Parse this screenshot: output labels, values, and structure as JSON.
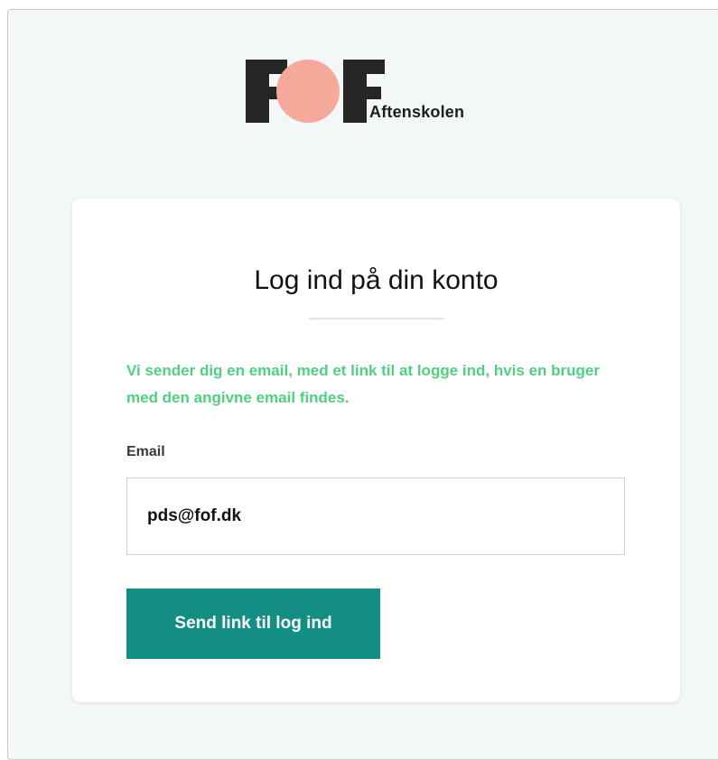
{
  "brand": {
    "logo_letters": "FOF",
    "subtitle": "Aftenskolen",
    "colors": {
      "dark": "#262626",
      "circle": "#f5a99b"
    }
  },
  "login": {
    "title": "Log ind på din konto",
    "notice": "Vi sender dig en email, med et link til at logge ind, hvis en bruger med den angivne email findes.",
    "email_label": "Email",
    "email_value": "pds@fof.dk",
    "submit_label": "Send link til log ind"
  },
  "colors": {
    "page_bg": "#f3f7f7",
    "notice_green": "#4fd080",
    "button_teal": "#138e85"
  }
}
